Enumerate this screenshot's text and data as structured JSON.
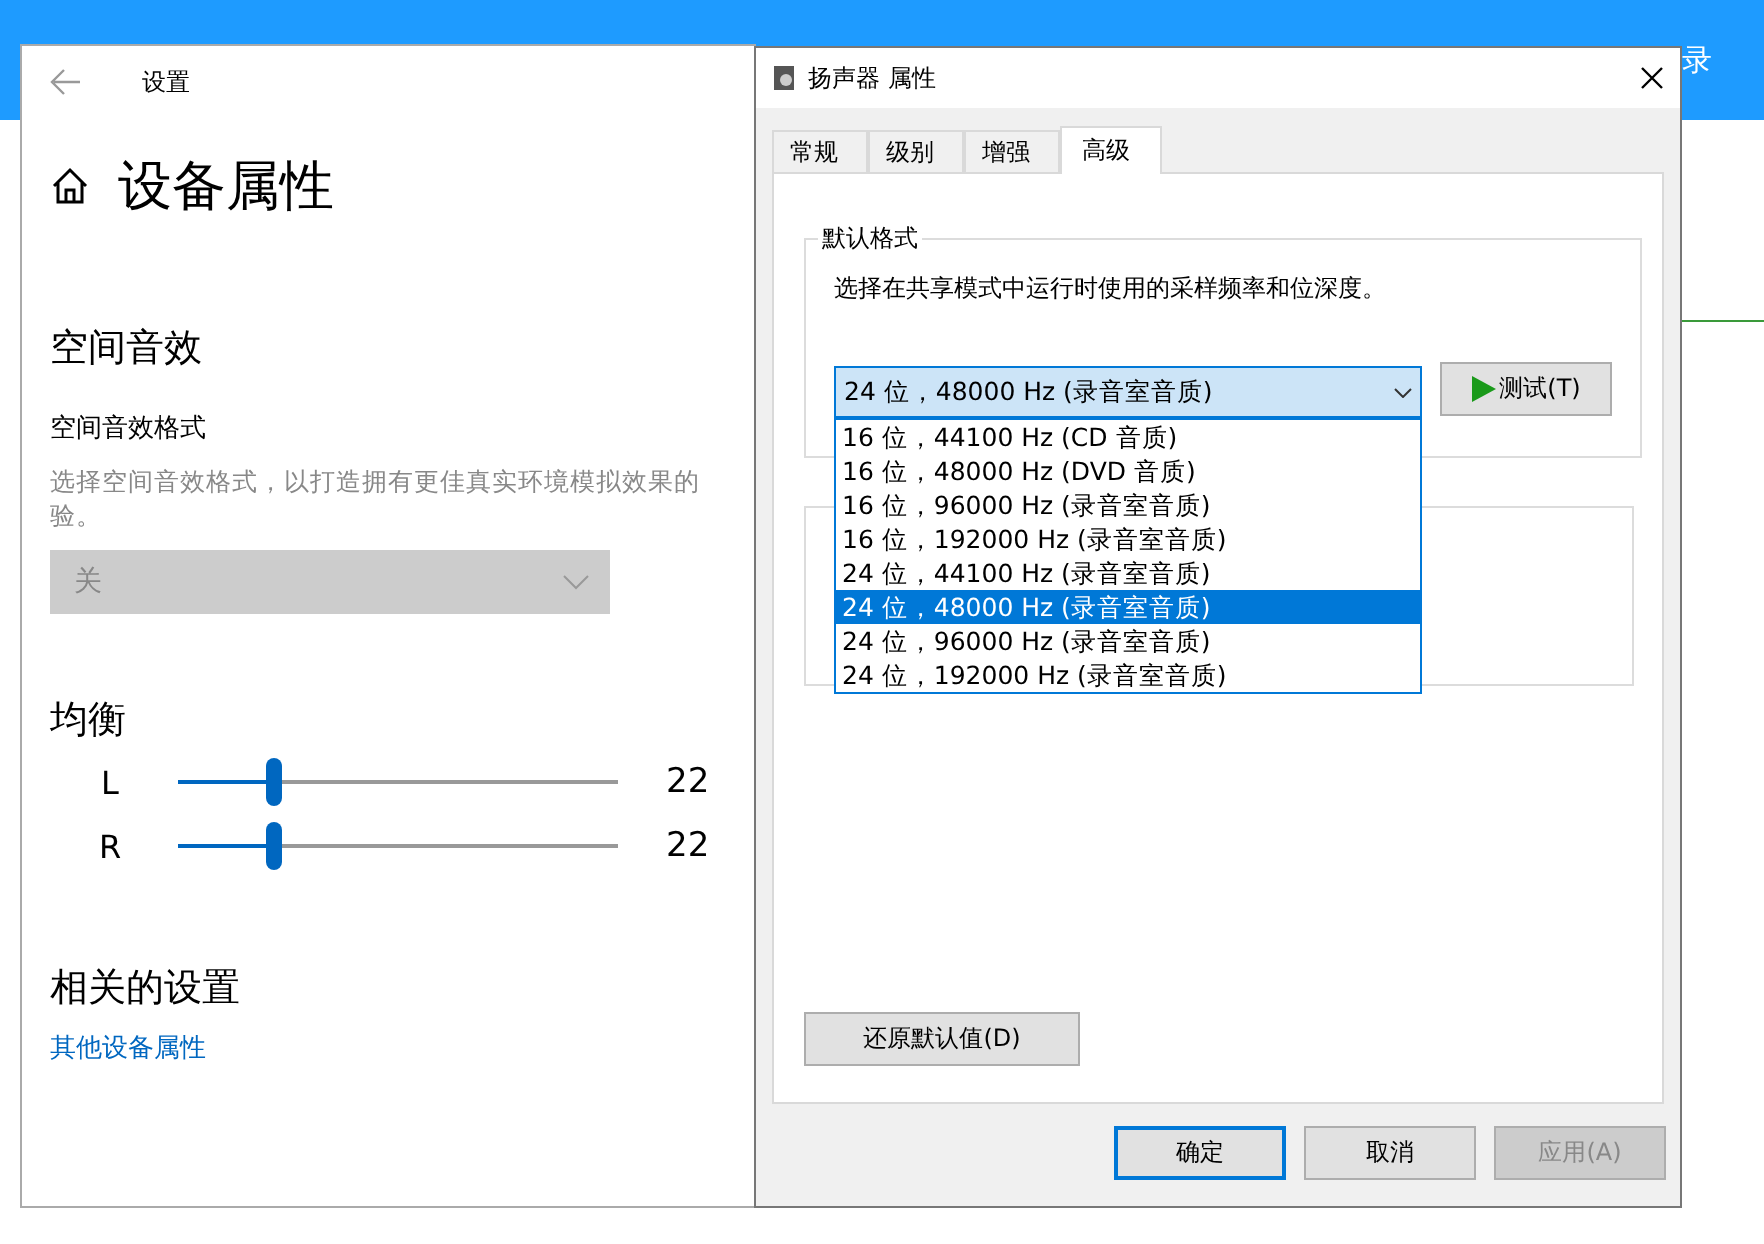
{
  "background": {
    "header_texts": [
      "录"
    ]
  },
  "settings": {
    "title": "设置",
    "heading": "设备属性",
    "spatial": {
      "heading": "空间音效",
      "label": "空间音效格式",
      "description_lines": [
        "选择空间音效格式，以打造拥有更佳真实环境模拟效果的",
        "验。"
      ],
      "dropdown": {
        "value": "关",
        "disabled": true
      }
    },
    "balance": {
      "heading": "均衡",
      "channels": [
        {
          "name": "L",
          "level": 0.22,
          "reading": "22"
        },
        {
          "name": "R",
          "level": 0.22,
          "reading": "22"
        }
      ]
    },
    "related": {
      "heading": "相关的设置",
      "link": "其他设备属性"
    }
  },
  "dialog": {
    "title": "扬声器 属性",
    "tabs": [
      {
        "label": "常规",
        "selected": false
      },
      {
        "label": "级别",
        "selected": false
      },
      {
        "label": "增强",
        "selected": false
      },
      {
        "label": "高级",
        "selected": true
      }
    ],
    "group": {
      "title": "默认格式",
      "description": "选择在共享模式中运行时使用的采样频率和位深度。",
      "dropdown": {
        "value": "24 位，48000 Hz (录音室音质)",
        "expanded": true,
        "options": [
          {
            "label": "16 位，44100 Hz (CD 音质)",
            "selected": false
          },
          {
            "label": "16 位，48000 Hz (DVD 音质)",
            "selected": false
          },
          {
            "label": "16 位，96000 Hz (录音室音质)",
            "selected": false
          },
          {
            "label": "16 位，192000 Hz (录音室音质)",
            "selected": false
          },
          {
            "label": "24 位，44100 Hz (录音室音质)",
            "selected": false
          },
          {
            "label": "24 位，48000 Hz (录音室音质)",
            "selected": true
          },
          {
            "label": "24 位，96000 Hz (录音室音质)",
            "selected": false
          },
          {
            "label": "24 位，192000 Hz (录音室音质)",
            "selected": false
          }
        ]
      },
      "test_button": "测试(T)"
    },
    "restore_button": "还原默认值(D)",
    "buttons": [
      {
        "label": "确定",
        "kind": "default",
        "disabled": false
      },
      {
        "label": "取消",
        "kind": "normal",
        "disabled": false
      },
      {
        "label": "应用(A)",
        "kind": "normal",
        "disabled": true
      }
    ]
  }
}
